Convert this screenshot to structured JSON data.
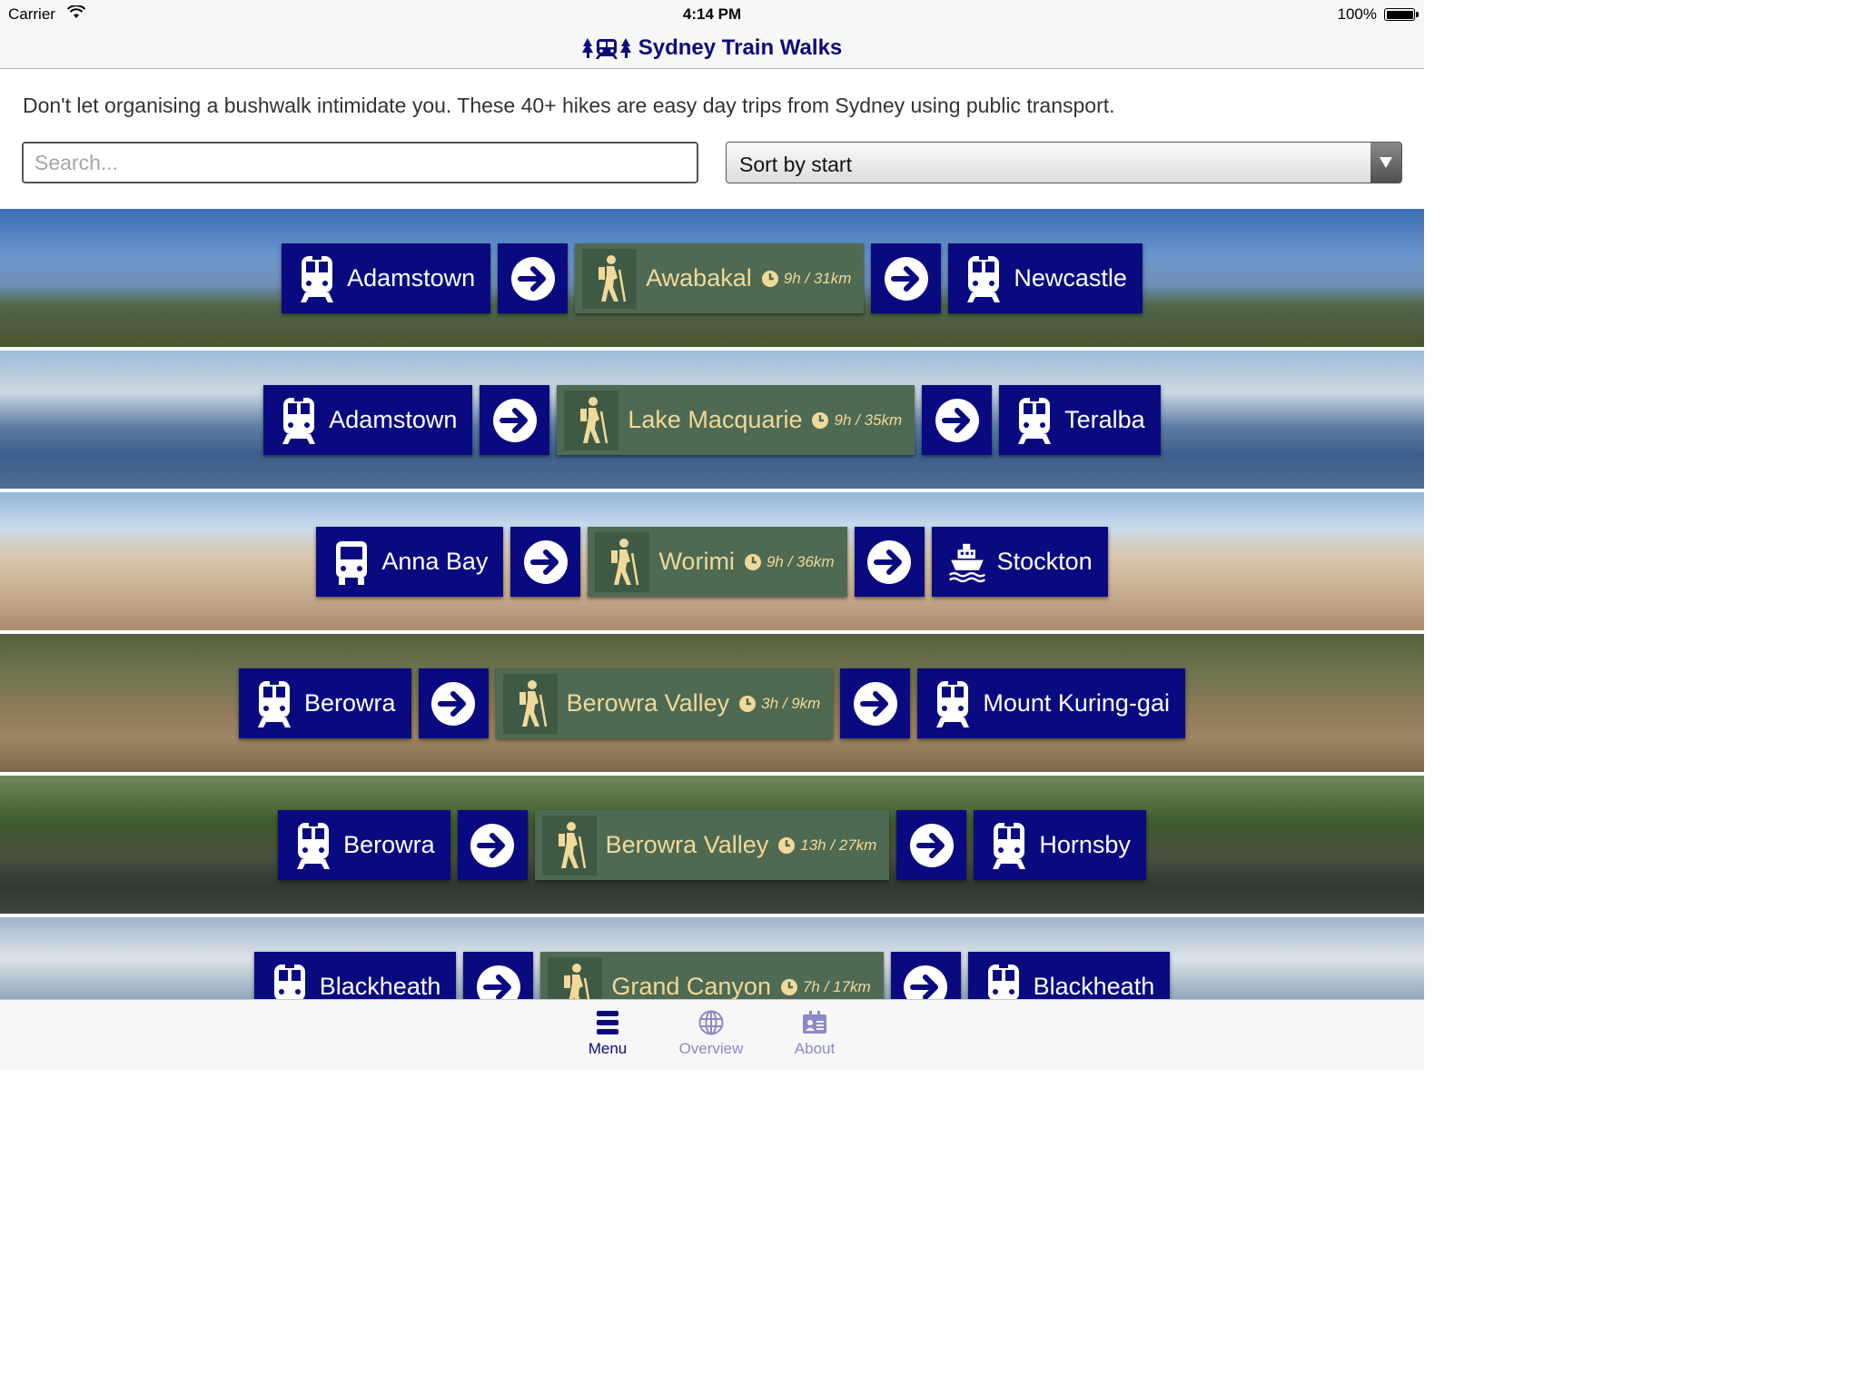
{
  "status_bar": {
    "carrier": "Carrier",
    "time": "4:14 PM",
    "battery": "100%"
  },
  "app": {
    "title": "Sydney Train Walks"
  },
  "intro": "Don't let organising a bushwalk intimidate you. These 40+ hikes are easy day trips from Sydney using public transport.",
  "search": {
    "placeholder": "Search...",
    "value": ""
  },
  "sort": {
    "selected": "Sort by start"
  },
  "walks": [
    {
      "start": "Adamstown",
      "start_mode": "train",
      "name": "Awabakal",
      "duration": "9h / 31km",
      "end": "Newcastle",
      "end_mode": "train"
    },
    {
      "start": "Adamstown",
      "start_mode": "train",
      "name": "Lake Macquarie",
      "duration": "9h / 35km",
      "end": "Teralba",
      "end_mode": "train"
    },
    {
      "start": "Anna Bay",
      "start_mode": "bus",
      "name": "Worimi",
      "duration": "9h / 36km",
      "end": "Stockton",
      "end_mode": "ferry"
    },
    {
      "start": "Berowra",
      "start_mode": "train",
      "name": "Berowra Valley",
      "duration": "3h / 9km",
      "end": "Mount Kuring-gai",
      "end_mode": "train"
    },
    {
      "start": "Berowra",
      "start_mode": "train",
      "name": "Berowra Valley",
      "duration": "13h / 27km",
      "end": "Hornsby",
      "end_mode": "train"
    },
    {
      "start": "Blackheath",
      "start_mode": "train",
      "name": "Grand Canyon",
      "duration": "7h / 17km",
      "end": "Blackheath",
      "end_mode": "train"
    }
  ],
  "tabs": [
    {
      "label": "Menu",
      "icon": "menu-icon",
      "active": true
    },
    {
      "label": "Overview",
      "icon": "globe-icon",
      "active": false
    },
    {
      "label": "About",
      "icon": "contact-card-icon",
      "active": false
    }
  ],
  "colors": {
    "navy": "#0a0a80",
    "walk_tile": "#4f6a52",
    "walk_text": "#f0d99a"
  }
}
